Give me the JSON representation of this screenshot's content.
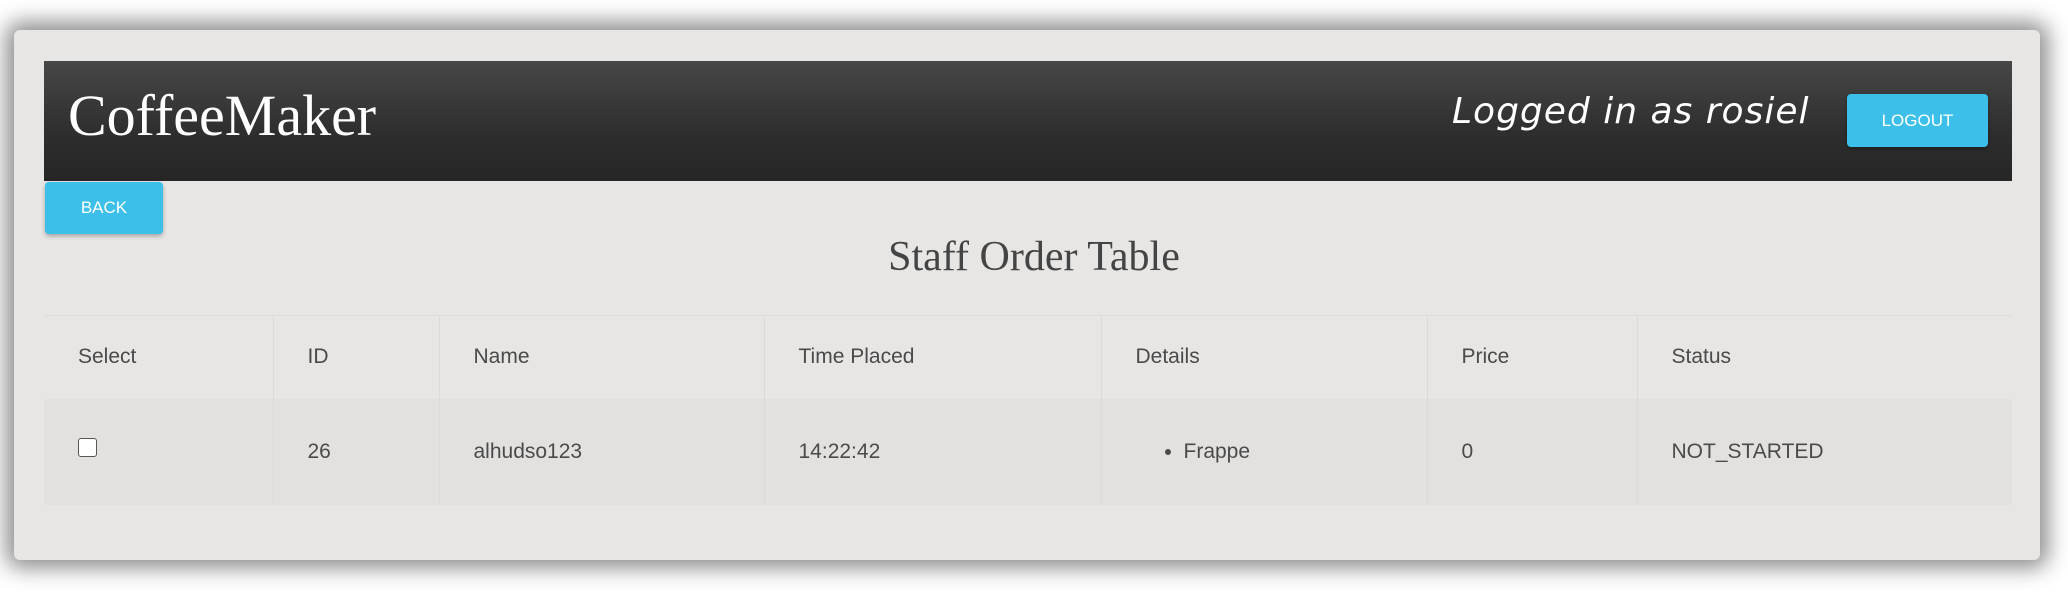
{
  "header": {
    "brand": "CoffeeMaker",
    "logged_in_text": "Logged in as rosiel",
    "logout_label": "LOGOUT"
  },
  "nav": {
    "back_label": "BACK"
  },
  "page": {
    "title": "Staff Order Table"
  },
  "table": {
    "columns": [
      "Select",
      "ID",
      "Name",
      "Time Placed",
      "Details",
      "Price",
      "Status"
    ],
    "rows": [
      {
        "selected": false,
        "id": "26",
        "name": "alhudso123",
        "time_placed": "14:22:42",
        "details": [
          "Frappe"
        ],
        "price": "0",
        "status": "NOT_STARTED"
      }
    ]
  },
  "colors": {
    "accent": "#3cc0ea",
    "navbar": "#2e2e2e",
    "background": "#e8e6e4"
  }
}
